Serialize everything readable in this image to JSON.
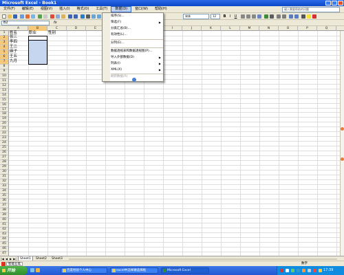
{
  "window": {
    "title": "Microsoft Excel - Book1"
  },
  "menubar": {
    "items": [
      {
        "label": "文件(F)"
      },
      {
        "label": "编辑(E)"
      },
      {
        "label": "视图(V)"
      },
      {
        "label": "插入(I)"
      },
      {
        "label": "格式(O)"
      },
      {
        "label": "工具(T)"
      },
      {
        "label": "数据(D)"
      },
      {
        "label": "窗口(W)"
      },
      {
        "label": "帮助(H)"
      }
    ],
    "help_placeholder": "键入需要帮助的问题"
  },
  "toolbar": {
    "font_name": "宋体",
    "font_size": "12",
    "bold": "B",
    "italic": "I",
    "underline": "U"
  },
  "formula_bar": {
    "name_box": "B2",
    "fx": "fx"
  },
  "columns": [
    "A",
    "B",
    "C",
    "D",
    "E",
    "F",
    "G",
    "H",
    "I",
    "J",
    "K",
    "L",
    "M",
    "N",
    "O",
    "P",
    "Q"
  ],
  "cells": {
    "A1": "姓名",
    "B1": "职业",
    "C1": "性别",
    "A2": "张三",
    "A3": "李四",
    "A4": "王二",
    "A5": "麻子",
    "A6": "王五",
    "A7": "九月"
  },
  "data_menu": {
    "items": [
      {
        "label": "排序(S)...",
        "has_sub": false,
        "disabled": false
      },
      {
        "label": "筛选(F)",
        "has_sub": true,
        "disabled": false
      },
      {
        "label": "分类汇总(B)...",
        "has_sub": false,
        "disabled": false
      },
      {
        "label": "有效性(L)...",
        "has_sub": false,
        "disabled": false
      },
      {
        "label": "分列(E)...",
        "has_sub": false,
        "disabled": false
      },
      {
        "label": "数据透视表和数据透视图(P)...",
        "has_sub": false,
        "disabled": false
      },
      {
        "label": "导入外部数据(D)",
        "has_sub": true,
        "disabled": false
      },
      {
        "label": "列表(I)",
        "has_sub": true,
        "disabled": false
      },
      {
        "label": "XML(X)",
        "has_sub": true,
        "disabled": false
      },
      {
        "label": "刷新数据(R)",
        "has_sub": false,
        "disabled": true
      }
    ]
  },
  "sheets": [
    "Sheet1",
    "Sheet2",
    "Sheet3"
  ],
  "status": {
    "input_method": "智能五笔",
    "mode": "数字"
  },
  "taskbar": {
    "start": "开始",
    "items": [
      "百度经验个人中心",
      "excel中怎样做选择框",
      "Microsoft Excel"
    ],
    "clock": "17:39"
  }
}
